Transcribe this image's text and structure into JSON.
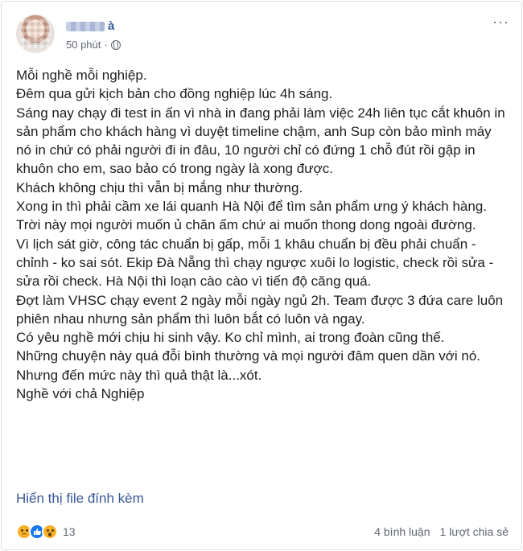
{
  "post": {
    "author_suffix": "à",
    "time": "50 phút",
    "separator": "·",
    "lines": [
      "Mỗi nghề mỗi nghiệp.",
      "Đêm qua gửi kịch bản cho đồng nghiệp lúc 4h sáng.",
      "Sáng nay chạy đi test in ấn vì nhà in đang phải làm việc 24h liên tục cắt khuôn in sản phẩm cho khách hàng vì duyệt timeline chậm, anh Sup còn bảo mình máy nó in chứ có phải người đi in đâu, 10 người chỉ có đứng 1 chỗ đút rồi gập in khuôn cho em, sao bảo có trong ngày là xong được.",
      "Khách không chịu thì vẫn bị mắng như thường.",
      "Xong in thì phải cầm xe lái quanh Hà Nội để tìm sản phẩm ưng ý khách hàng. Trời này mọi người muốn ủ chăn ấm chứ ai muốn thong dong ngoài đường.",
      "Vì lịch sát giờ, công tác chuẩn bị gấp, mỗi 1 khâu chuẩn bị đều phải chuẩn - chỉnh - ko sai sót. Ekip Đà Nẵng thì chạy ngược xuôi lo logistic, check rồi sửa - sửa rồi check. Hà Nội thì loạn cào cào vì tiến độ căng quá.",
      "Đợt làm VHSC chạy event 2 ngày mỗi ngày ngủ 2h. Team được 3 đứa care luôn phiên nhau nhưng sản phẩm thì luôn bắt có luôn và ngay.",
      "Có yêu nghề mới chịu hi sinh vậy. Ko chỉ mình, ai trong đoàn cũng thế.",
      "Những chuyện này quá đỗi bình thường và mọi người đâm quen dần với nó.",
      "Nhưng đến mức này thì quả thật là...xót.",
      "Nghề với chả Nghiệp"
    ],
    "attachment_link": "Hiển thị file đính kèm",
    "reaction_count": "13",
    "comments": "4 bình luận",
    "shares": "1 lượt chia sẻ"
  },
  "icons": {
    "privacy": "globe-icon",
    "more": "more-options-icon",
    "reactions": [
      "sad-reaction-icon",
      "like-reaction-icon",
      "wow-reaction-icon"
    ]
  },
  "colors": {
    "link": "#385898",
    "secondary_text": "#616770",
    "like_blue": "#1877f2",
    "emoji_yellow": "#f7b125"
  }
}
